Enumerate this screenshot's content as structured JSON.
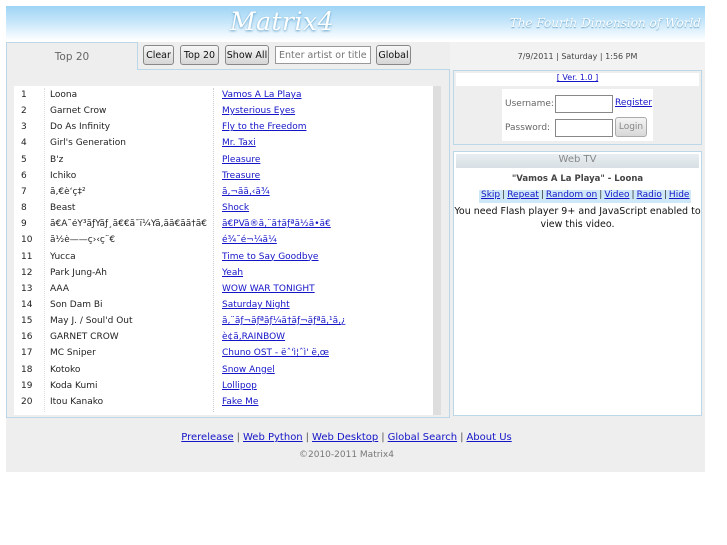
{
  "header": {
    "logo": "Matrix4",
    "tagline": "The Fourth Dimension of World"
  },
  "toolbar": {
    "tab_label": "Top 20",
    "clear_label": "Clear",
    "top20_label": "Top 20",
    "showall_label": "Show All",
    "search_placeholder": "Enter artist or title",
    "global_label": "Global"
  },
  "tracks": [
    {
      "num": "1",
      "artist": "Loona",
      "title": "Vamos A La Playa"
    },
    {
      "num": "2",
      "artist": "Garnet Crow",
      "title": "Mysterious Eyes"
    },
    {
      "num": "3",
      "artist": "Do As Infinity",
      "title": "Fly to the Freedom"
    },
    {
      "num": "4",
      "artist": "Girl's Generation",
      "title": "Mr. Taxi"
    },
    {
      "num": "5",
      "artist": "B'z",
      "title": "Pleasure"
    },
    {
      "num": "6",
      "artist": "Ichiko",
      "title": "Treasure"
    },
    {
      "num": "7",
      "artist": "ã‚€è‘ç‡²",
      "title": "ã‚¬ãã‚‹ã¾"
    },
    {
      "num": "8",
      "artist": "Beast",
      "title": "Shock"
    },
    {
      "num": "9",
      "artist": "ã€Ã˜éŸ³ãƒŸãƒ¸ã€€ã¯ï¼Ÿã‚ãã€ãã†ã€",
      "title": "ã€PVã®ã‚¨ã†ãƒªã½ã•ã€"
    },
    {
      "num": "10",
      "artist": "ã½è——ç›‹ç¨€",
      "title": "é¾˜é¬¼ã¼"
    },
    {
      "num": "11",
      "artist": "Yucca",
      "title": "Time to Say Goodbye"
    },
    {
      "num": "12",
      "artist": "Park Jung-Ah",
      "title": "Yeah"
    },
    {
      "num": "13",
      "artist": "AAA",
      "title": "WOW WAR TONIGHT"
    },
    {
      "num": "14",
      "artist": "Son Dam Bi",
      "title": "Saturday Night"
    },
    {
      "num": "15",
      "artist": "May J. / Soul'd Out",
      "title": "ã‚¨ãƒ¬ãƒªãƒ¼ã†ãƒ¬ãƒªã‚¹ã‚¿"
    },
    {
      "num": "16",
      "artist": "GARNET CROW",
      "title": "è¢ã‚RAINBOW"
    },
    {
      "num": "17",
      "artist": "MC Sniper",
      "title": "Chuno OST - ëˆ'ì¦ˆì' ë‚œ"
    },
    {
      "num": "18",
      "artist": "Kotoko",
      "title": "Snow Angel"
    },
    {
      "num": "19",
      "artist": "Koda Kumi",
      "title": "Lollipop"
    },
    {
      "num": "20",
      "artist": "Itou Kanako",
      "title": "Fake Me"
    }
  ],
  "datebar": "7/9/2011 | Saturday | 1:56 PM",
  "login": {
    "version": "[ Ver. 1.0 ]",
    "username_label": "Username:",
    "password_label": "Password:",
    "register_label": "Register",
    "login_label": "Login"
  },
  "webtv": {
    "heading": "Web TV",
    "now_playing": "\"Vamos A La Playa\"  -  Loona",
    "controls": [
      "Skip",
      "Repeat",
      "Random on",
      "Video",
      "Radio",
      "Hide"
    ],
    "message": "You need Flash player 9+ and JavaScript enabled to view this video."
  },
  "footer": {
    "links": [
      "Prerelease",
      "Web Python",
      "Web Desktop",
      "Global Search",
      "About Us"
    ],
    "copyright": "©2010-2011 Matrix4"
  },
  "colors": {
    "link": "#1515c8",
    "panel_border": "#bcd7e8",
    "header_gradient_top": "#9fd4f5"
  }
}
